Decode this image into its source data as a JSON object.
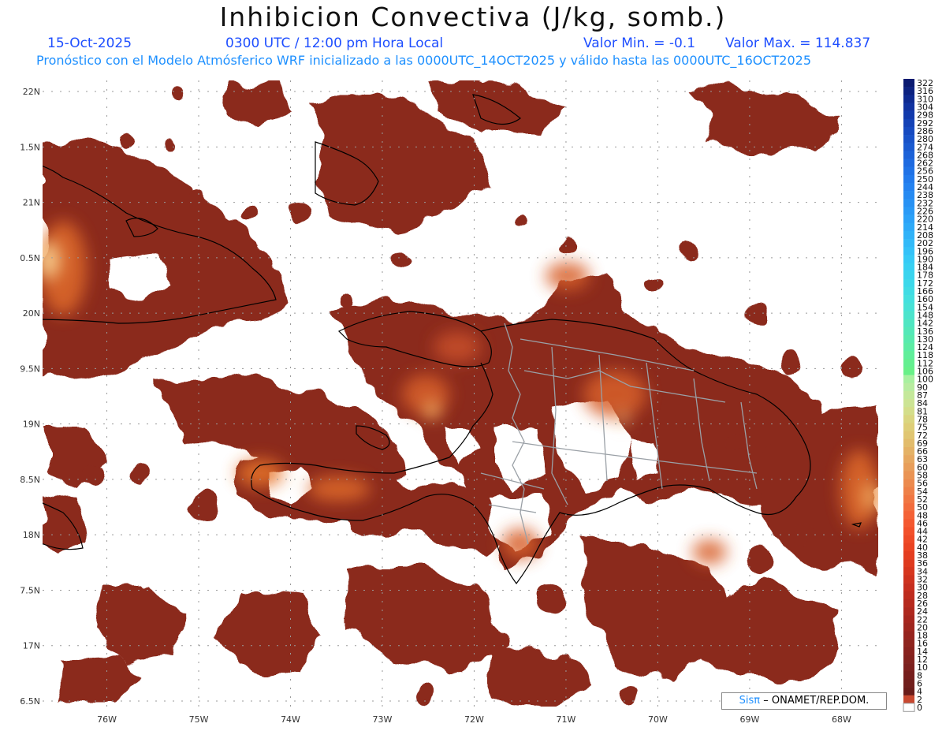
{
  "header": {
    "title": "Inhibicion Convectiva (J/kg, somb.)",
    "date": "15-Oct-2025",
    "time": "0300 UTC / 12:00 pm Hora Local",
    "valor_min": "Valor Min. = -0.1",
    "valor_max": "Valor Max. = 114.837",
    "forecast_line": "Pronóstico con el Modelo Atmósferico WRF inicializado a las 0000UTC_14OCT2025 y válido hasta las  0000UTC_16OCT2025"
  },
  "map": {
    "lon_range": [
      -76.7,
      -67.6
    ],
    "lat_range": [
      16.45,
      22.1
    ],
    "lat_ticks": [
      {
        "value": 22.0,
        "label": "22N"
      },
      {
        "value": 21.5,
        "label": "1.5N"
      },
      {
        "value": 21.0,
        "label": "21N"
      },
      {
        "value": 20.5,
        "label": "0.5N"
      },
      {
        "value": 20.0,
        "label": "20N"
      },
      {
        "value": 19.5,
        "label": "9.5N"
      },
      {
        "value": 19.0,
        "label": "19N"
      },
      {
        "value": 18.5,
        "label": "8.5N"
      },
      {
        "value": 18.0,
        "label": "18N"
      },
      {
        "value": 17.5,
        "label": "7.5N"
      },
      {
        "value": 17.0,
        "label": "17N"
      },
      {
        "value": 16.5,
        "label": "6.5N"
      }
    ],
    "lon_ticks": [
      {
        "value": -76,
        "label": "76W"
      },
      {
        "value": -75,
        "label": "75W"
      },
      {
        "value": -74,
        "label": "74W"
      },
      {
        "value": -73,
        "label": "73W"
      },
      {
        "value": -72,
        "label": "72W"
      },
      {
        "value": -71,
        "label": "71W"
      },
      {
        "value": -70,
        "label": "70W"
      },
      {
        "value": -69,
        "label": "69W"
      },
      {
        "value": -68,
        "label": "68W"
      }
    ],
    "shading_colors": {
      "light": "#d0552a",
      "mid": "#e86a20",
      "dark": "#8b2a1f",
      "peak": "#f6b86a"
    }
  },
  "colorbar": {
    "labels": [
      "322",
      "316",
      "310",
      "304",
      "298",
      "292",
      "286",
      "280",
      "274",
      "268",
      "262",
      "256",
      "250",
      "244",
      "238",
      "232",
      "226",
      "220",
      "214",
      "208",
      "202",
      "196",
      "190",
      "184",
      "178",
      "172",
      "166",
      "160",
      "154",
      "148",
      "142",
      "136",
      "130",
      "124",
      "118",
      "112",
      "106",
      "100",
      "90",
      "87",
      "84",
      "81",
      "78",
      "75",
      "72",
      "69",
      "66",
      "63",
      "60",
      "58",
      "56",
      "54",
      "52",
      "50",
      "48",
      "46",
      "44",
      "42",
      "40",
      "38",
      "36",
      "34",
      "32",
      "30",
      "28",
      "26",
      "24",
      "22",
      "20",
      "18",
      "16",
      "14",
      "12",
      "10",
      "8",
      "6",
      "4",
      "2",
      "0"
    ],
    "colors": [
      "#0a1a70",
      "#0c2280",
      "#0e2a90",
      "#1032a0",
      "#123aac",
      "#1442b6",
      "#164ac0",
      "#1852c8",
      "#1a5ad0",
      "#1c62d8",
      "#1e6ae0",
      "#2072e6",
      "#227aec",
      "#2482f0",
      "#268af2",
      "#2892f4",
      "#2a9af6",
      "#2ca2f8",
      "#2eaaf8",
      "#30b2f8",
      "#32baf8",
      "#34c2f8",
      "#36caf6",
      "#38d0f2",
      "#3ad4ee",
      "#3cd8ea",
      "#40dce4",
      "#44e0de",
      "#48e2d6",
      "#4ce4cc",
      "#50e6c2",
      "#54e8b8",
      "#58eaae",
      "#5ceca4",
      "#60ee9a",
      "#64ef90",
      "#68f088",
      "#a8f0a0",
      "#b8eca0",
      "#c4e89a",
      "#cce494",
      "#d4de8a",
      "#dad680",
      "#dece78",
      "#e0c672",
      "#e2bc6c",
      "#e4b266",
      "#e6a860",
      "#e89e5a",
      "#ea9454",
      "#ec8a4e",
      "#ee8048",
      "#f07642",
      "#f26c3c",
      "#f46236",
      "#f45830",
      "#f2502a",
      "#ee4a26",
      "#ea4422",
      "#e43e20",
      "#de3a1e",
      "#d6361e",
      "#ce321e",
      "#c62e1e",
      "#be2c1e",
      "#b62a1e",
      "#ae281e",
      "#a6261e",
      "#9e261e",
      "#96241e",
      "#8e241e",
      "#88221e",
      "#82221e",
      "#7c201e",
      "#761e1c",
      "#701e1c",
      "#6a1c1a",
      "#c84830",
      "#ffffff"
    ]
  },
  "credit": {
    "brand": "Sisπ",
    "text": "– ONAMET/REP.DOM."
  }
}
